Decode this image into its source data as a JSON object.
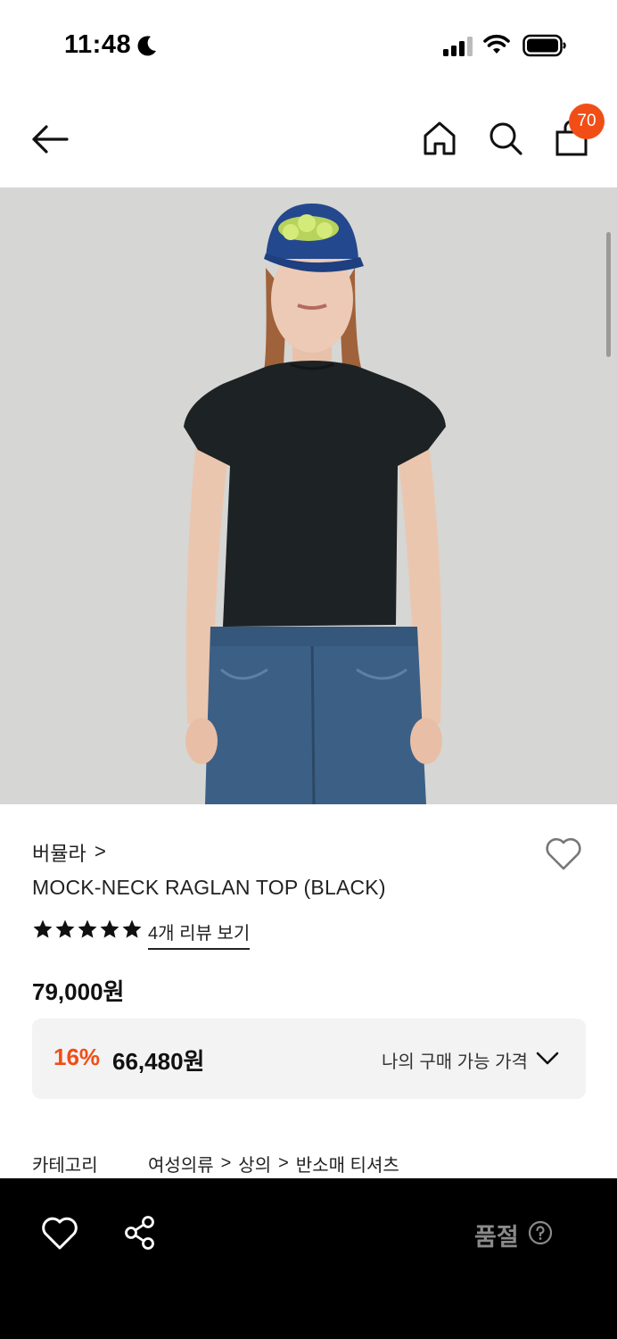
{
  "status_bar": {
    "time": "11:48",
    "icons": [
      "moon-icon",
      "cellular-signal-icon",
      "wifi-icon",
      "battery-icon"
    ]
  },
  "nav": {
    "icons": [
      "back-arrow-icon",
      "home-icon",
      "search-icon",
      "shopping-bag-icon"
    ],
    "cart_count": "70"
  },
  "product": {
    "image_alt": "Model wearing black mock-neck raglan top with blue jeans and navy cap",
    "brand": "버뮬라",
    "brand_chevron": ">",
    "name": "MOCK-NECK RAGLAN TOP (BLACK)",
    "rating_stars": 5,
    "review_link": "4개 리뷰 보기",
    "price": "79,000원",
    "discount": {
      "percent": "16%",
      "price": "66,480원",
      "my_price_label": "나의 구매 가능 가격"
    },
    "category": {
      "label": "카테고리",
      "path": [
        "여성의류",
        "상의",
        "반소매 티셔츠"
      ],
      "separator": ">"
    }
  },
  "bottom_bar": {
    "status": "품절",
    "icons": [
      "heart-icon",
      "share-icon",
      "help-icon"
    ]
  },
  "colors": {
    "accent": "#f04e16",
    "bottom_bar_bg": "#000000",
    "discount_box_bg": "#f3f3f3",
    "hero_bg": "#d6d6d4"
  }
}
